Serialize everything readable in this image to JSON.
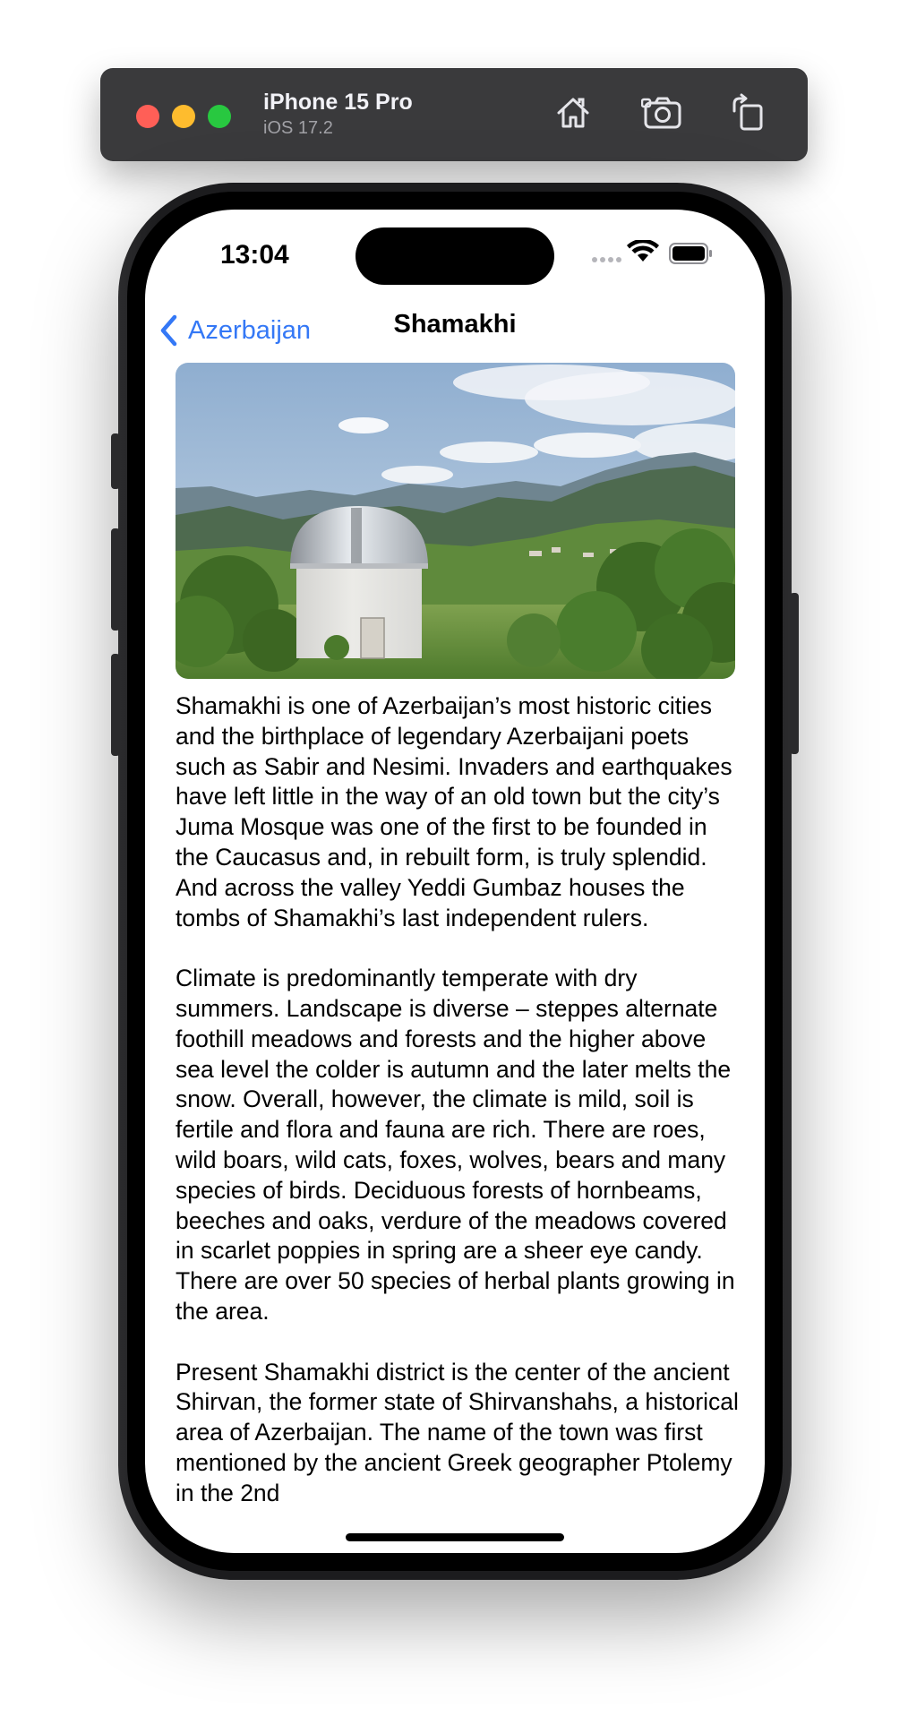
{
  "simulator": {
    "device_name": "iPhone 15 Pro",
    "os_version": "iOS 17.2",
    "buttons": [
      "home-icon",
      "screenshot-icon",
      "rotate-icon"
    ]
  },
  "status_bar": {
    "time": "13:04",
    "icons": [
      "cellular-dots-icon",
      "wifi-icon",
      "battery-icon"
    ]
  },
  "nav": {
    "back_label": "Azerbaijan",
    "title": "Shamakhi"
  },
  "hero_image": {
    "subject": "observatory-dome-in-mountains"
  },
  "body": {
    "paragraphs": [
      "Shamakhi is one of Azerbaijan’s most historic cities and the birthplace of legendary Azerbaijani poets such as Sabir and Nesimi. Invaders and earthquakes have left little in the way of an old town but the city’s Juma Mosque was one of the first to be founded in the Caucasus and, in rebuilt form, is truly splendid. And across the valley Yeddi Gumbaz houses the tombs of Shamakhi’s last independent rulers.",
      "Climate is predominantly temperate with dry summers. Landscape is diverse – steppes alternate foothill meadows and forests and the higher above sea level the colder is autumn and the later melts the snow. Overall, however, the climate is mild, soil is fertile and flora and fauna are rich. There are roes, wild boars, wild cats, foxes, wolves, bears and many species of birds. Deciduous forests of hornbeams, beeches and oaks, verdure of the meadows covered in scarlet poppies in spring are a sheer eye candy. There are over 50 species of herbal plants growing in the area.",
      "Present Shamakhi district is the center of the ancient Shirvan, the former state of Shirvanshahs, a historical area of Azerbaijan. The name of the town was first mentioned by the ancient Greek geographer Ptolemy in the 2nd"
    ]
  },
  "colors": {
    "accent": "#3478f6",
    "toolbar": "#3a3a3c",
    "close": "#ff5f57",
    "minimize": "#febc2e",
    "zoom": "#28c840"
  }
}
